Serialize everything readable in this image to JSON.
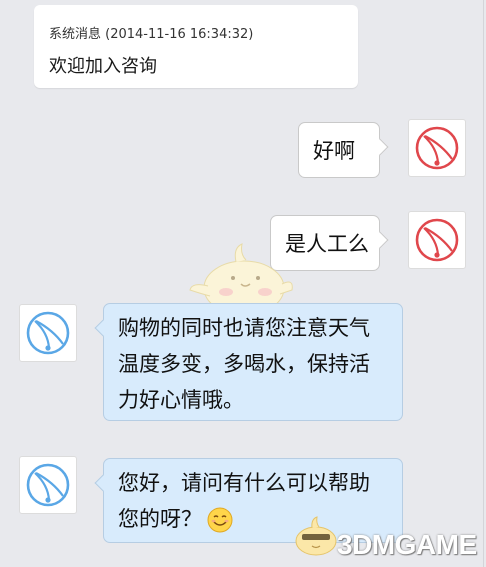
{
  "system_message": {
    "header": "系统消息 (2014-11-16 16:34:32)",
    "body": "欢迎加入咨询"
  },
  "messages": [
    {
      "side": "right",
      "lines": [
        "好啊"
      ],
      "avatar_icon": "red-bell-icon"
    },
    {
      "side": "right",
      "lines": [
        "是人工么"
      ],
      "avatar_icon": "red-bell-icon"
    },
    {
      "side": "left",
      "lines": [
        "购物的同时也请您注意天气",
        "温度多变，多喝水，保持活",
        "力好心情哦。"
      ],
      "avatar_icon": "blue-bell-icon"
    },
    {
      "side": "left",
      "lines": [
        "您好，请问有什么可以帮助",
        "您的呀？"
      ],
      "avatar_icon": "blue-bell-icon",
      "emoji": "smile-emoji"
    }
  ],
  "watermark": "3DMGAME",
  "colors": {
    "background": "#e8e9ed",
    "outgoing_bubble": "#ffffff",
    "incoming_bubble": "#d8ebfc",
    "red_avatar": "#e0474c",
    "blue_avatar": "#5aa7e6"
  }
}
